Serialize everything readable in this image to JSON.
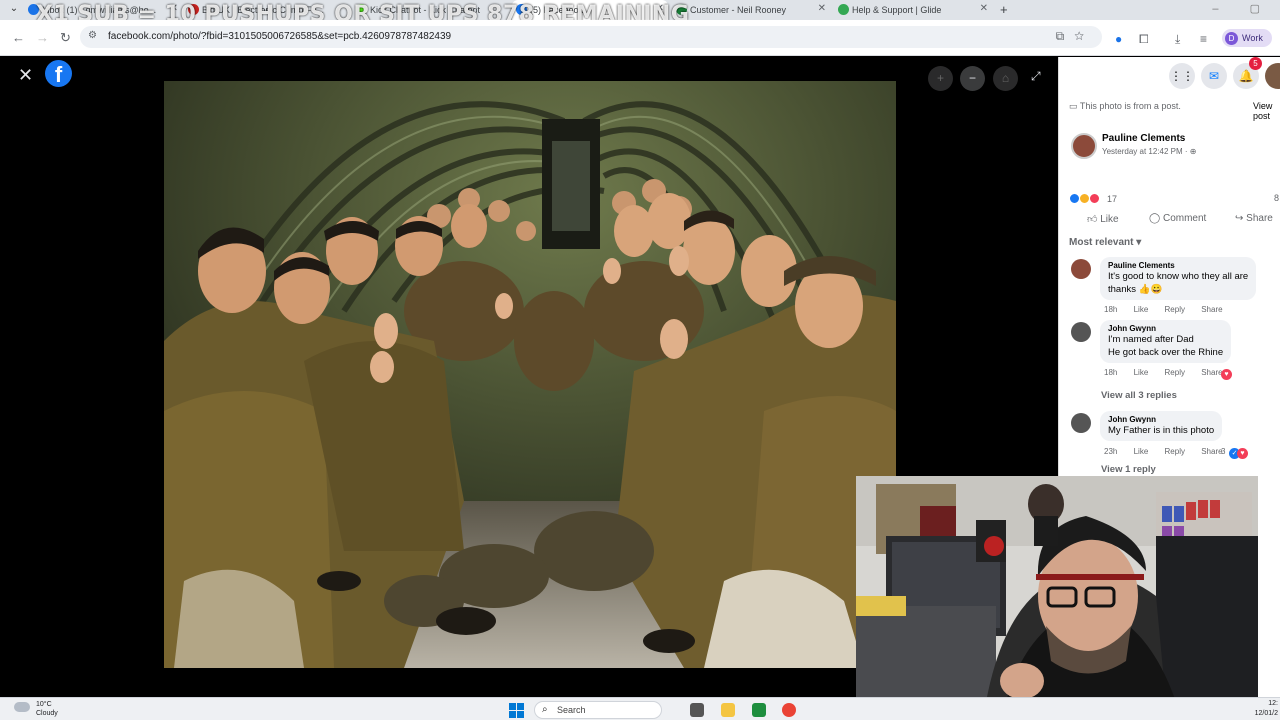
{
  "browser": {
    "tab_list_icon": "chevron-down-icon",
    "tabs": [
      {
        "label": "Inbox (1) - dmwilliams@ho...",
        "color": "#1a73e8"
      },
      {
        "label": "Big UK | Electronic Comp Fa...",
        "color": "#c5221f"
      },
      {
        "label": "Kick Chatbot - Kick Chatbot",
        "color": "#53fc18"
      },
      {
        "label": "(5) Facebook",
        "color": "#1877f2"
      },
      {
        "label": "Customer - Neil Rooney",
        "color": "#188038"
      },
      {
        "label": "Help & Support | Glide",
        "color": "#34a853"
      }
    ],
    "new_tab": "+",
    "overlay_banner": "X1 SUB = 10 PUSHUPS OR SIT UPS 878 REMAINING",
    "url": "facebook.com/photo/?fbid=3101505006726585&set=pcb.4260978787482439",
    "profile_label": "Work",
    "profile_initial": "D"
  },
  "viewer": {
    "close": "✕",
    "logo": "f",
    "zoom_in": "+",
    "zoom_out": "−",
    "tag": "⌂",
    "fullscreen": "⤢"
  },
  "panel": {
    "notif_count": "5",
    "from_post": "This photo is from a post.",
    "view_post": "View post",
    "author": "Pauline Clements",
    "time": "Yesterday at 12:42 PM · ⊕",
    "reaction_count": "17",
    "reaction_right": "8",
    "like": "Like",
    "comment": "Comment",
    "share": "Share",
    "most_relevant": "Most relevant ▾",
    "comments": [
      {
        "name": "Pauline Clements",
        "lines": [
          "It's good to know who they all are",
          "thanks 👍😀"
        ],
        "age": "18h",
        "color": "#8c4a3a"
      },
      {
        "name": "John Gwynn",
        "lines": [
          "I'm named after Dad",
          "He got back over the Rhine"
        ],
        "age": "18h",
        "color": "#555"
      },
      {
        "name": "John Gwynn",
        "lines": [
          "My Father is in this photo"
        ],
        "age": "23h",
        "color": "#555",
        "count": "3"
      }
    ],
    "view_replies_1": "View all 3 replies",
    "view_replies_2": "View 1 reply",
    "meta_like": "Like",
    "meta_reply": "Reply",
    "meta_share": "Share"
  },
  "taskbar": {
    "temp": "10°C",
    "condition": "Cloudy",
    "search": "Search",
    "time": "12:",
    "date": "12/01/2"
  }
}
